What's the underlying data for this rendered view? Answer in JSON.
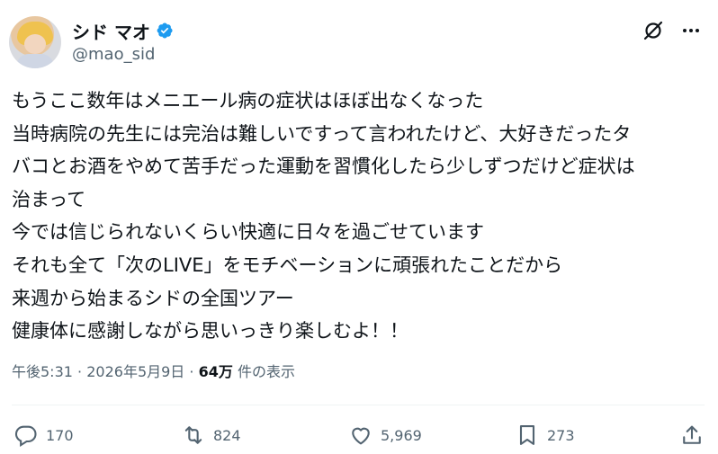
{
  "user": {
    "display_name": "シド マオ",
    "handle": "@mao_sid",
    "verified_icon": "verified-badge-icon",
    "brand_color": "#1d9bf0"
  },
  "tweet": {
    "lines": [
      "もうここ数年はメニエール病の症状はほぼ出なくなった",
      "当時病院の先生には完治は難しいですって言われたけど、大好きだったタ",
      "バコとお酒をやめて苦手だった運動を習慣化したら少しずつだけど症状は",
      "治まって",
      "今では信じられないくらい快適に日々を過ごせています",
      "それも全て「次のLIVE」をモチベーションに頑張れたことだから",
      "来週から始まるシドの全国ツアー",
      "健康体に感謝しながら思いっきり楽しむよ！！"
    ],
    "time": "午後5:31",
    "separator": "·",
    "date": "2026年5月9日",
    "views_count": "64万",
    "views_label": "件の表示"
  },
  "actions": {
    "reply_count": "170",
    "retweet_count": "824",
    "like_count": "5,969",
    "bookmark_count": "273"
  }
}
